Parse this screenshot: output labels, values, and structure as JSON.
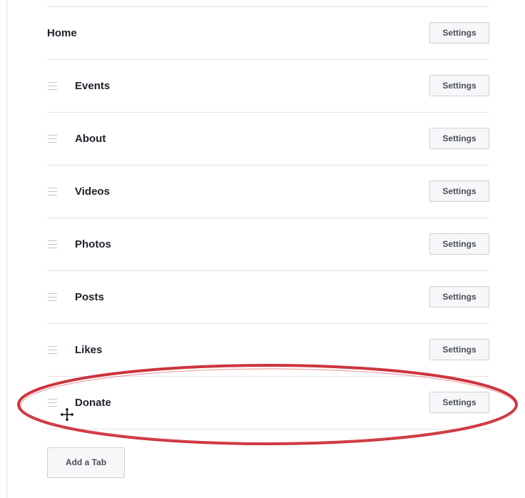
{
  "tabs": [
    {
      "label": "Home",
      "settings_label": "Settings",
      "reorderable": false
    },
    {
      "label": "Events",
      "settings_label": "Settings",
      "reorderable": true
    },
    {
      "label": "About",
      "settings_label": "Settings",
      "reorderable": true
    },
    {
      "label": "Videos",
      "settings_label": "Settings",
      "reorderable": true
    },
    {
      "label": "Photos",
      "settings_label": "Settings",
      "reorderable": true
    },
    {
      "label": "Posts",
      "settings_label": "Settings",
      "reorderable": true
    },
    {
      "label": "Likes",
      "settings_label": "Settings",
      "reorderable": true
    },
    {
      "label": "Donate",
      "settings_label": "Settings",
      "reorderable": true
    }
  ],
  "add_tab_label": "Add a Tab",
  "colors": {
    "highlight_ellipse": "#c8232c",
    "button_background": "#f6f7f9",
    "button_border": "#ced0d4",
    "divider": "#e2e4e8"
  },
  "icons": {
    "drag_handle": "hamburger-lines-icon",
    "cursor": "move-cursor-icon"
  }
}
